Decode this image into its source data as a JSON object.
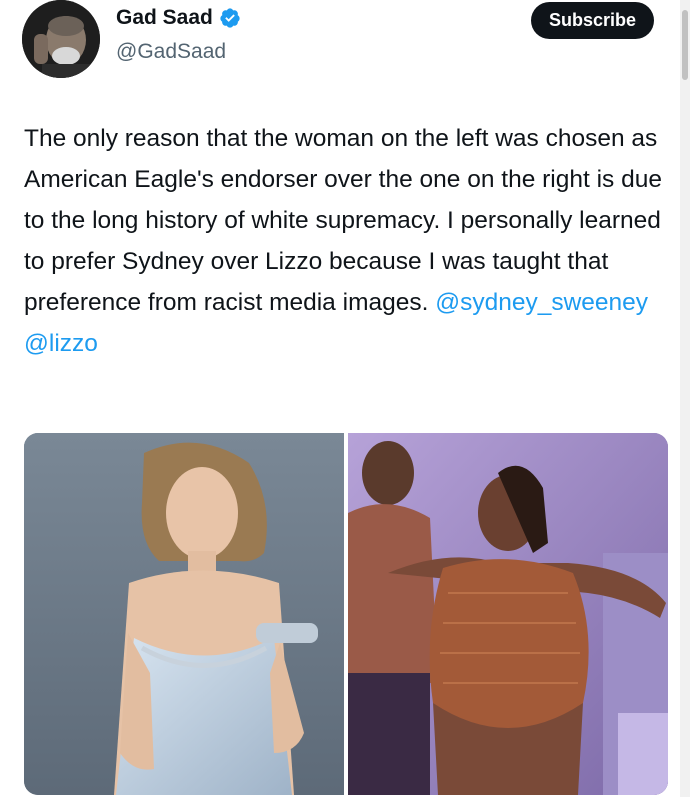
{
  "tweet": {
    "author": {
      "display_name": "Gad Saad",
      "handle": "@GadSaad",
      "verified": true,
      "avatar_icon": "avatar-photo",
      "verified_icon": "verified-badge-icon"
    },
    "subscribe_label": "Subscribe",
    "text_parts": {
      "body": "The only reason that the woman on the left was chosen as American Eagle's endorser over the one on the right is due to the long history of white supremacy.  I personally learned to prefer Sydney over Lizzo because I was taught that preference from racist media images. ",
      "mention1": "@sydney_sweeney",
      "mention2": "@lizzo"
    },
    "media": {
      "count": 2,
      "left_photo": "woman-in-light-blue-satin-gown",
      "right_photo": "performer-on-stage-in-brown-outfit"
    }
  },
  "colors": {
    "text": "#0f1419",
    "secondary": "#536471",
    "link": "#1d9bf0",
    "button_bg": "#0f1419",
    "button_text": "#ffffff"
  }
}
